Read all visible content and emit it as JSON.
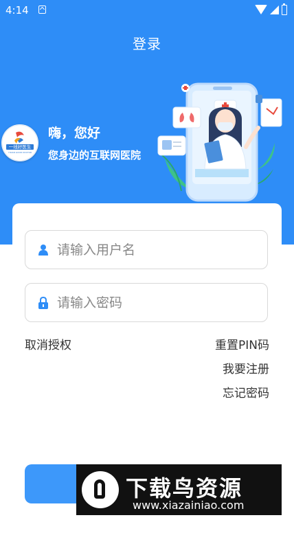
{
  "status": {
    "time": "4:14"
  },
  "header": {
    "title": "登录"
  },
  "hero": {
    "greeting": "嗨，您好",
    "tagline": "您身边的互联网医院",
    "logo_text": "一线好医生",
    "logo_subtext": "YIXIAN GOOD DOCTOR"
  },
  "form": {
    "username_placeholder": "请输入用户名",
    "password_placeholder": "请输入密码",
    "cancel_auth": "取消授权",
    "reset_pin": "重置PIN码",
    "register": "我要注册",
    "forgot_password": "忘记密码",
    "login_label": ""
  },
  "watermark": {
    "title": "下载鸟资源",
    "url": "www.xiazainiao.com"
  },
  "colors": {
    "primary": "#2e8df7",
    "button": "#3d98fa",
    "icon": "#2e8df7"
  }
}
